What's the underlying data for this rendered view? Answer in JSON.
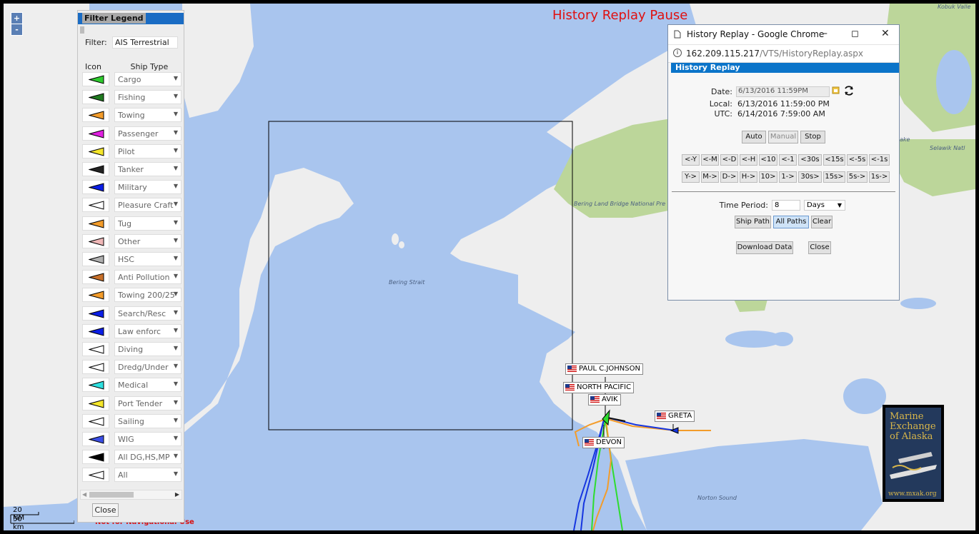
{
  "map": {
    "overlay_title": "History Replay Pause",
    "zoom_in": "+",
    "zoom_out": "-",
    "labels": {
      "bering_strait": "Bering Strait",
      "bering_land_bridge": "Bering Land Bridge National Pre",
      "norton_sound": "Norton Sound",
      "selawik": "Selawik Natl",
      "kobuk": "Kobuk Valle",
      "lake": "ake"
    },
    "ships": [
      {
        "name": "PAUL C.JOHNSON"
      },
      {
        "name": "NORTH PACIFIC"
      },
      {
        "name": "AVIK"
      },
      {
        "name": "GRETA"
      },
      {
        "name": "DEVON"
      }
    ],
    "scale": {
      "nm": "20 NM",
      "km": "50 km"
    },
    "disclaimer": "Not for Navigational Use",
    "logo": {
      "line1": "Marine",
      "line2": "Exchange",
      "line3": "of Alaska",
      "url": "www.mxak.org"
    }
  },
  "legend": {
    "title": "Filter Legend",
    "filter_label": "Filter:",
    "filter_value": "AIS Terrestrial",
    "col_icon": "Icon",
    "col_type": "Ship Type",
    "close_label": "Close",
    "rows": [
      {
        "label": "Cargo",
        "color": "#2ecc2e"
      },
      {
        "label": "Fishing",
        "color": "#1f7a1f"
      },
      {
        "label": "Towing",
        "color": "#f39c2a"
      },
      {
        "label": "Passenger",
        "color": "#e01ee0"
      },
      {
        "label": "Pilot",
        "color": "#f5e62a"
      },
      {
        "label": "Tanker",
        "color": "#222222"
      },
      {
        "label": "Military",
        "color": "#0a1ee6"
      },
      {
        "label": "Pleasure Craft",
        "color": "#ffffff"
      },
      {
        "label": "Tug",
        "color": "#f39c2a"
      },
      {
        "label": "Other",
        "color": "#f0b8b8"
      },
      {
        "label": "HSC",
        "color": "#b0b0b0"
      },
      {
        "label": "Anti Pollution",
        "color": "#c8702a"
      },
      {
        "label": "Towing 200/25",
        "color": "#f39c2a"
      },
      {
        "label": "Search/Resc",
        "color": "#0a1ee6"
      },
      {
        "label": "Law enforc",
        "color": "#0a1ee6"
      },
      {
        "label": "Diving",
        "color": "#ffffff"
      },
      {
        "label": "Dredg/Under",
        "color": "#ffffff"
      },
      {
        "label": "Medical",
        "color": "#2ee0e0"
      },
      {
        "label": "Port Tender",
        "color": "#f5e62a"
      },
      {
        "label": "Sailing",
        "color": "#ffffff"
      },
      {
        "label": "WIG",
        "color": "#3a4ee6"
      },
      {
        "label": "All DG,HS,MP",
        "color": "#000000"
      },
      {
        "label": "All",
        "color": "#ffffff"
      }
    ]
  },
  "popup": {
    "window_title": "History Replay - Google Chrome",
    "url_host": "162.209.115.217",
    "url_path": "/VTS/HistoryReplay.aspx",
    "header": "History Replay",
    "date_label": "Date:",
    "date_value": "6/13/2016 11:59PM",
    "local_label": "Local:",
    "local_value": "6/13/2016 11:59:00 PM",
    "utc_label": "UTC:",
    "utc_value": "6/14/2016 7:59:00 AM",
    "auto": "Auto",
    "manual": "Manual",
    "stop": "Stop",
    "back_buttons": [
      "<-Y",
      "<-M",
      "<-D",
      "<-H",
      "<10",
      "<-1",
      "<30s",
      "<15s",
      "<-5s",
      "<-1s"
    ],
    "fwd_buttons": [
      "Y->",
      "M->",
      "D->",
      "H->",
      "10>",
      "1->",
      "30s>",
      "15s>",
      "5s->",
      "1s->"
    ],
    "time_period_label": "Time Period:",
    "time_period_value": "8",
    "time_unit": "Days",
    "ship_path": "Ship Path",
    "all_paths": "All Paths",
    "clear": "Clear",
    "download": "Download Data",
    "close": "Close"
  }
}
